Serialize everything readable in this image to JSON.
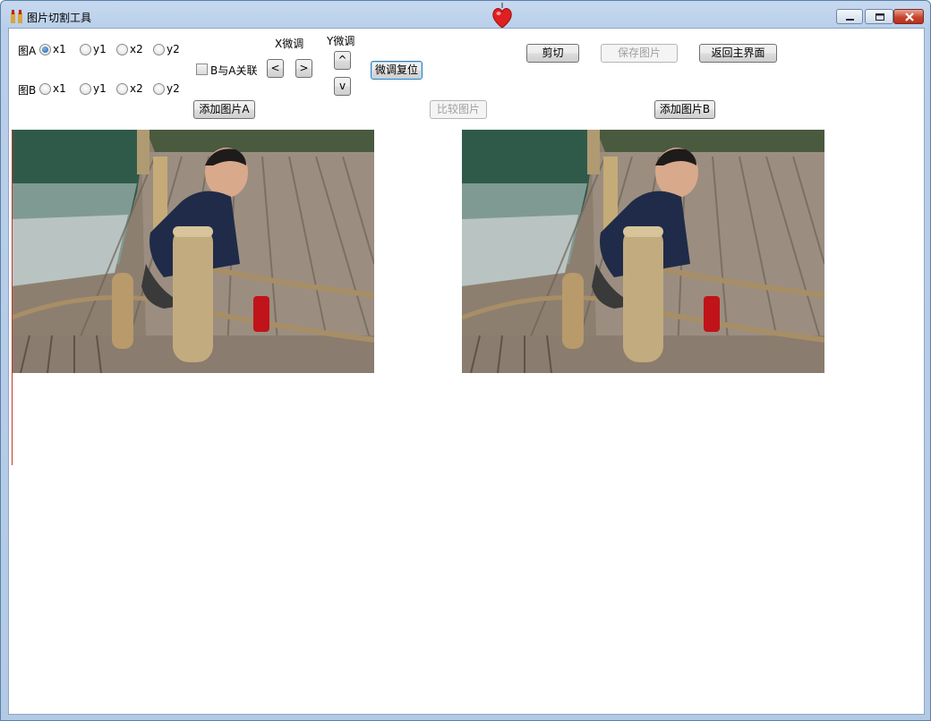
{
  "window": {
    "title": "图片切割工具"
  },
  "controls": {
    "image_a_label": "图A",
    "image_b_label": "图B",
    "radio_x1": "x1",
    "radio_y1": "y1",
    "radio_x2": "x2",
    "radio_y2": "y2",
    "selected_radio_a": "x1",
    "link_checkbox_label": "B与A关联",
    "link_checked": false,
    "x_adjust_label": "X微调",
    "y_adjust_label": "Y微调",
    "x_left": "<",
    "x_right": ">",
    "y_up": "^",
    "y_down": "v",
    "reset_adjust": "微调复位",
    "cut": "剪切",
    "save_image": "保存图片",
    "back_main": "返回主界面",
    "add_image_a": "添加图片A",
    "compare_images": "比较图片",
    "add_image_b": "添加图片B"
  },
  "colors": {
    "title_gradient_top": "#c7d9ef",
    "close_button": "#c8442d",
    "selection_line": "#c0392b"
  },
  "icons": [
    "app-icon",
    "heart-lantern-icon",
    "minimize-icon",
    "maximize-icon",
    "close-icon"
  ]
}
